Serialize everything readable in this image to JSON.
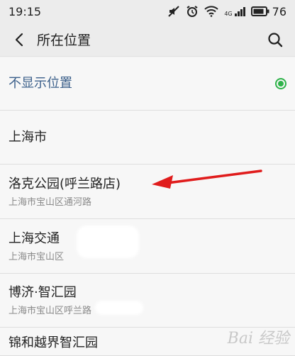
{
  "status": {
    "time": "19:15",
    "network": "4G",
    "battery": "76"
  },
  "header": {
    "title": "所在位置"
  },
  "list": [
    {
      "name": "不显示位置",
      "addr": "",
      "selected": true
    },
    {
      "name": "上海市",
      "addr": ""
    },
    {
      "name": "洛克公园(呼兰路店)",
      "addr": "上海市宝山区通河路"
    },
    {
      "name": "上海交通",
      "addr": "上海市宝山区"
    },
    {
      "name": "博济·智汇园",
      "addr": "上海市宝山区呼兰路"
    },
    {
      "name": "锦和越界智汇园",
      "addr": ""
    }
  ],
  "watermark": "Bai 经验",
  "colors": {
    "accent_green": "#2fb34a",
    "link_blue": "#3b5f8a",
    "annotation_red": "#e01c1c"
  }
}
